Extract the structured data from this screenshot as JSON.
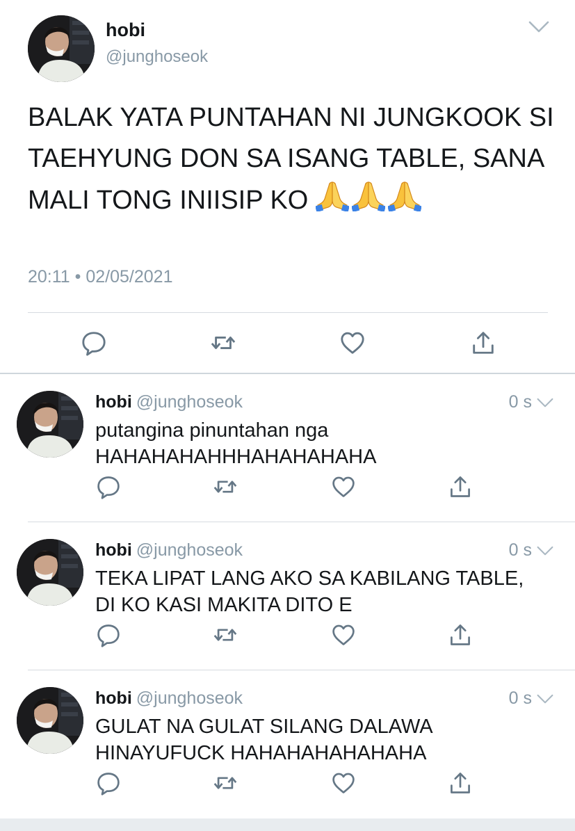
{
  "main_tweet": {
    "name": "hobi",
    "handle": "@junghoseok",
    "text": "BALAK YATA PUNTAHAN NI JUNGKOOK SI TAEHYUNG DON SA ISANG TABLE, SANA MALI TONG INIISIP KO",
    "emoji": "🙏🙏🙏",
    "emoji_count": 3,
    "timestamp": "20:11 • 02/05/2021",
    "icons": [
      "reply-icon",
      "retweet-icon",
      "like-icon",
      "share-icon"
    ]
  },
  "replies": [
    {
      "name": "hobi",
      "handle": "@junghoseok",
      "time_ago": "0 s",
      "text_line1": "putangina pinuntahan nga",
      "text_line2": "HAHAHAHAHHHAHAHAHAHA"
    },
    {
      "name": "hobi",
      "handle": "@junghoseok",
      "time_ago": "0 s",
      "text_line1": "TEKA LIPAT LANG AKO SA KABILANG TABLE,",
      "text_line2": "DI KO KASI MAKITA DITO E"
    },
    {
      "name": "hobi",
      "handle": "@junghoseok",
      "time_ago": "0 s",
      "text_line1": "GULAT NA GULAT SILANG DALAWA",
      "text_line2": "HINAYUFUCK HAHAHAHAHAHAHA"
    }
  ],
  "colors": {
    "text": "#14171a",
    "secondary": "#8899a6",
    "icon": "#657786",
    "divider": "#d6dbe0"
  }
}
